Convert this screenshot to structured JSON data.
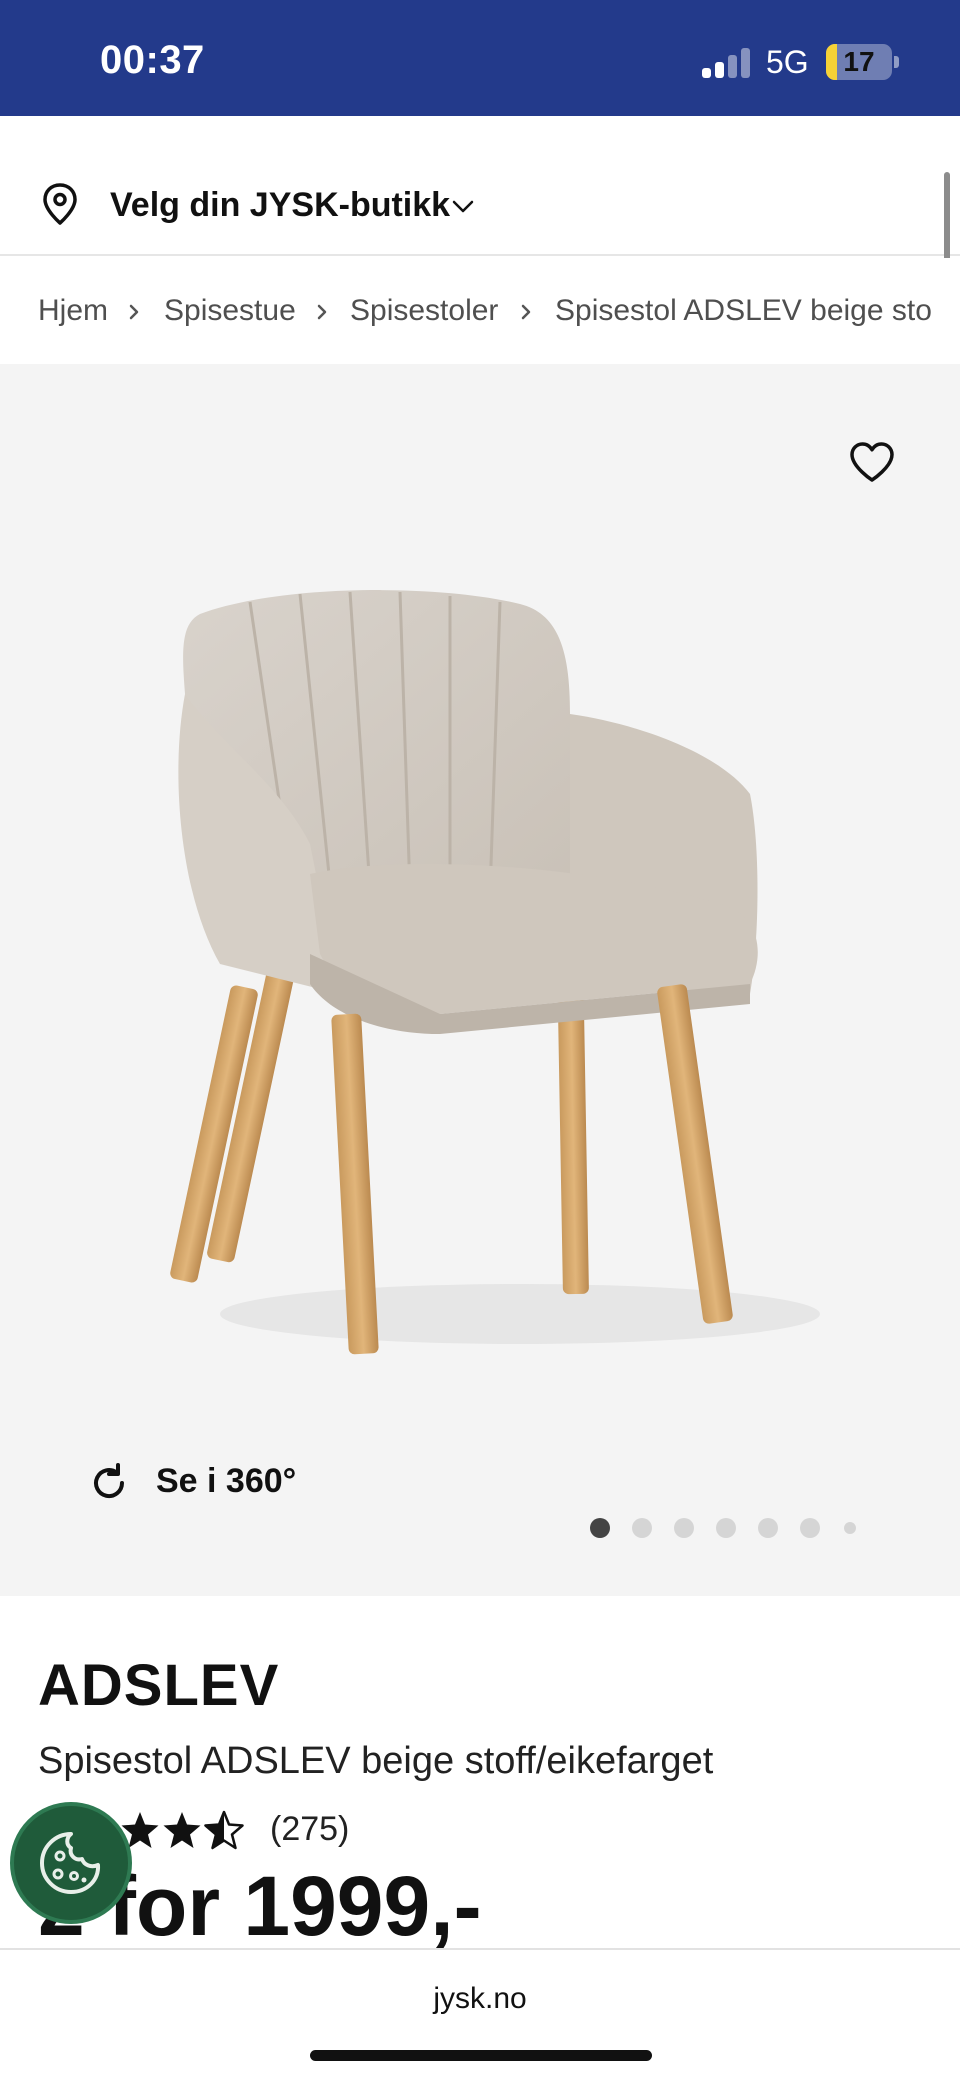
{
  "status_bar": {
    "time": "00:37",
    "network": "5G",
    "battery_level": "17",
    "battery_fraction": 0.17,
    "bg_color": "#233a8b"
  },
  "store": {
    "label": "Velg din JYSK-butikk",
    "icon": "map-pin-icon"
  },
  "breadcrumb": {
    "items": [
      "Hjem",
      "Spisestue",
      "Spisestoler",
      "Spisestol ADSLEV beige sto"
    ]
  },
  "gallery": {
    "favorite_icon": "heart-icon",
    "view_360_label": "Se i 360°",
    "image_count_visible": 7,
    "active_index": 0
  },
  "product": {
    "name": "ADSLEV",
    "description": "Spisestol ADSLEV beige stoff/eikefarget",
    "rating": 4.5,
    "rating_count": "(275)",
    "price": "2 for 1999,-"
  },
  "cookie": {
    "icon": "cookie-icon",
    "color": "#1f5b3a"
  },
  "browser": {
    "url": "jysk.no"
  }
}
